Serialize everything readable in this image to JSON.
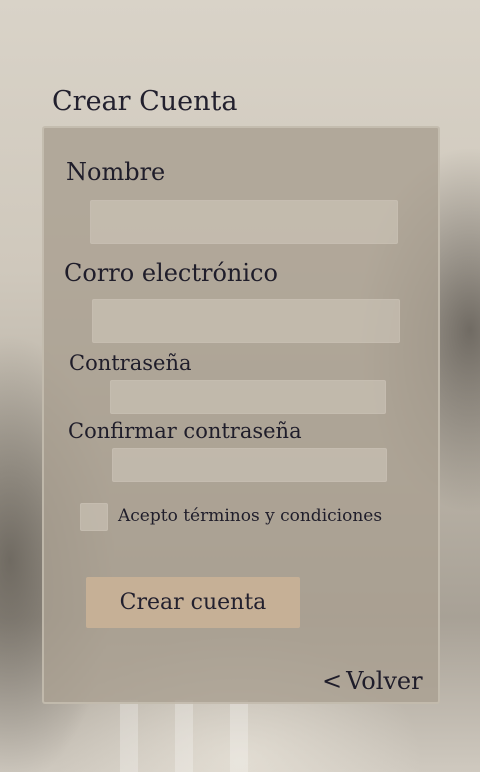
{
  "form": {
    "title": "Crear Cuenta",
    "fields": [
      {
        "label": "Nombre",
        "value": "",
        "placeholder": ""
      },
      {
        "label": "Corro electrónico",
        "value": "",
        "placeholder": ""
      },
      {
        "label": "Contraseña",
        "value": "",
        "placeholder": ""
      },
      {
        "label": "Confirmar contraseña",
        "value": "",
        "placeholder": ""
      }
    ],
    "terms_label": "Acepto términos y condiciones",
    "terms_checked": false,
    "submit_label": "Crear cuenta",
    "back_label": "Volver",
    "back_icon": "chevron-left-icon"
  },
  "colors": {
    "panel": "#aaa091",
    "input": "#d2cabe",
    "button": "#c6b096",
    "text": "#1f1d2a"
  }
}
